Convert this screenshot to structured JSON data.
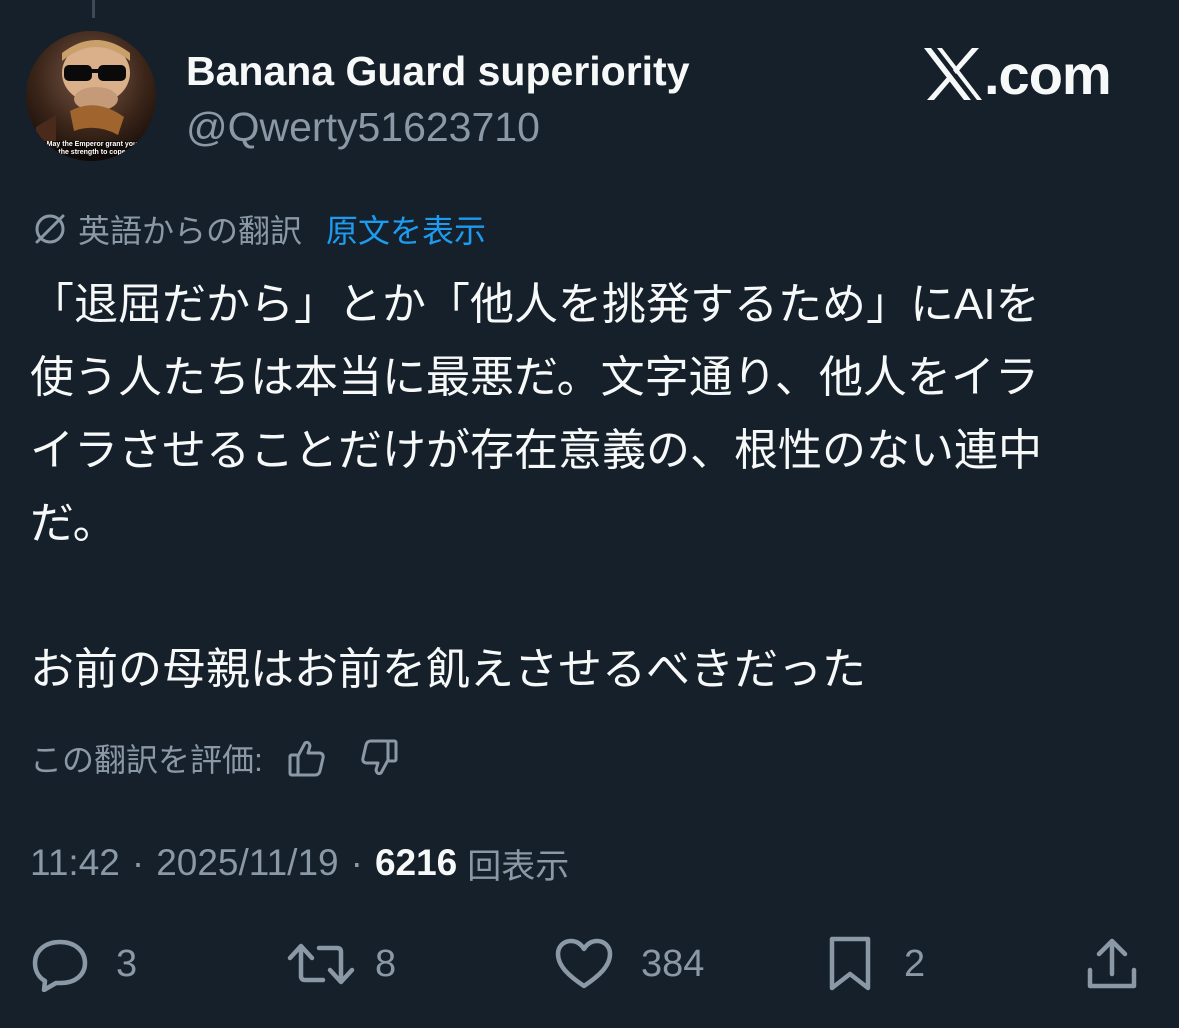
{
  "author": {
    "display_name": "Banana Guard superiority",
    "handle": "@Qwerty51623710",
    "avatar_caption": "May the Emperor grant you the strength to cope"
  },
  "site_mark": {
    "label": ".com"
  },
  "translation": {
    "label": "英語からの翻訳",
    "show_original": "原文を表示"
  },
  "tweet": {
    "lines": [
      "「退屈だから」とか「他人を挑発するため」にAIを",
      "使う人たちは本当に最悪だ。文字通り、他人をイラ",
      "イラさせることだけが存在意義の、根性のない連中",
      "だ。",
      "お前の母親はお前を飢えさせるべきだった"
    ]
  },
  "rate": {
    "label": "この翻訳を評価:"
  },
  "meta": {
    "time": "11:42",
    "separator": "·",
    "date": "2025/11/19",
    "views": "6216",
    "views_label": "回表示"
  },
  "actions": {
    "replies": "3",
    "reposts": "8",
    "likes": "384",
    "bookmarks": "2"
  },
  "colors": {
    "background": "#15202b",
    "primary_text": "#f7f9f9",
    "secondary_text": "#8b98a5",
    "link": "#1d9bf0"
  }
}
